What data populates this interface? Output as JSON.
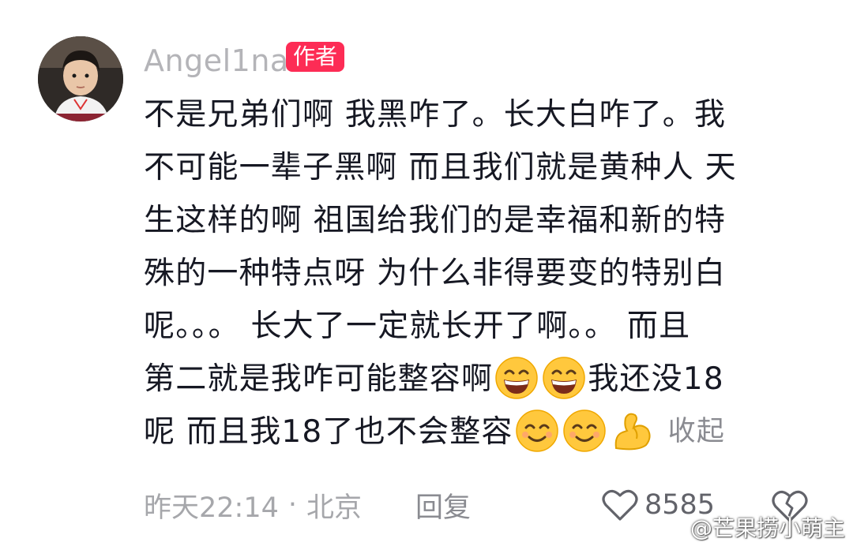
{
  "user": {
    "name": "Angel1na",
    "badge": "作者"
  },
  "comment": {
    "lines": [
      "不是兄弟们啊 我黑咋了。长大白咋了。我",
      "不可能一辈子黑啊 而且我们就是黄种人 天",
      "生这样的啊 祖国给我们的是幸福和新的特",
      "殊的一种特点呀 为什么非得要变的特别白",
      "呢。。。 长大了一定就长开了啊。。 而且"
    ],
    "line6_text_a": "第二就是我咋可能整容啊",
    "line6_text_b": " 我还没18",
    "line7_text": "呢 而且我18了也不会整容",
    "collapse_label": "收起",
    "emojis": [
      "grin-emoji",
      "grin-emoji",
      "smile-emoji",
      "smile-emoji",
      "flex-arm-emoji"
    ]
  },
  "meta": {
    "time": "昨天22:14",
    "separator": "·",
    "location": "北京",
    "reply_label": "回复",
    "like_count": "8585"
  },
  "watermark": {
    "text": "@芒果捞小萌主"
  },
  "colors": {
    "author_badge": "#fd2c55",
    "emoji_yellow": "#ffc83d"
  }
}
